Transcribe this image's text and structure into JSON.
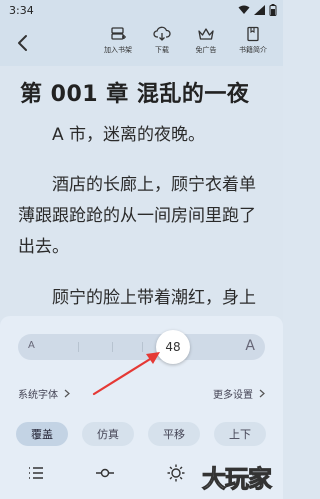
{
  "status_bar": {
    "time": "3:34"
  },
  "toolbar": {
    "add_to_shelf": "加入书架",
    "download": "下载",
    "ad_free": "免广告",
    "book_intro": "书籍简介"
  },
  "chapter": {
    "title": "第 001 章 混乱的一夜",
    "paragraphs": [
      "A 市，迷离的夜晚。",
      "酒店的长廊上，顾宁衣着单薄跟跟跄跄的从一间房间里跑了出去。",
      "顾宁的脸上带着潮红，身上的衣服凌乱的挂在身上。"
    ]
  },
  "settings": {
    "font_size_value": "48",
    "slider_min_label": "A",
    "slider_max_label": "A",
    "system_font": "系统字体",
    "more_settings": "更多设置",
    "page_modes": [
      "覆盖",
      "仿真",
      "平移",
      "上下"
    ],
    "active_mode": "覆盖"
  },
  "watermark": "大玩家",
  "colors": {
    "annotation_arrow": "#e53935"
  }
}
